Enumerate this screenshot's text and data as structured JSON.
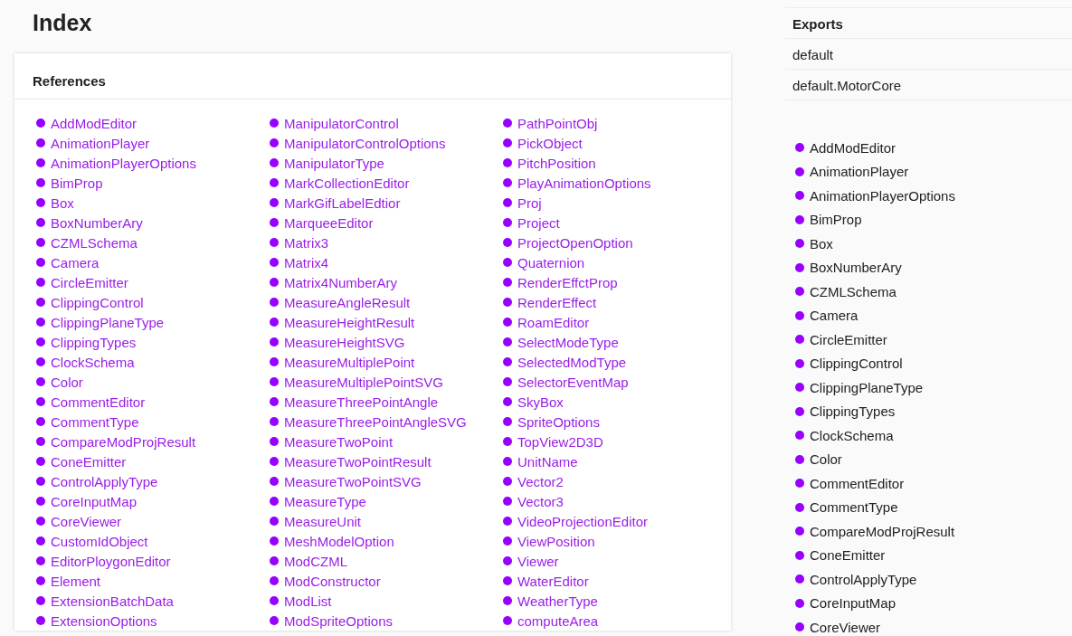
{
  "page": {
    "title": "Index"
  },
  "references": {
    "title": "References",
    "columns": [
      {
        "items": [
          "AddModEditor",
          "AnimationPlayer",
          "AnimationPlayerOptions",
          "BimProp",
          "Box",
          "BoxNumberAry",
          "CZMLSchema",
          "Camera",
          "CircleEmitter",
          "ClippingControl",
          "ClippingPlaneType",
          "ClippingTypes",
          "ClockSchema",
          "Color",
          "CommentEditor",
          "CommentType",
          "CompareModProjResult",
          "ConeEmitter",
          "ControlApplyType",
          "CoreInputMap",
          "CoreViewer",
          "CustomIdObject",
          "EditorPloygonEditor",
          "Element",
          "ExtensionBatchData",
          "ExtensionOptions"
        ]
      },
      {
        "items": [
          "ManipulatorControl",
          "ManipulatorControlOptions",
          "ManipulatorType",
          "MarkCollectionEditor",
          "MarkGifLabelEdtior",
          "MarqueeEditor",
          "Matrix3",
          "Matrix4",
          "Matrix4NumberAry",
          "MeasureAngleResult",
          "MeasureHeightResult",
          "MeasureHeightSVG",
          "MeasureMultiplePoint",
          "MeasureMultiplePointSVG",
          "MeasureThreePointAngle",
          "MeasureThreePointAngleSVG",
          "MeasureTwoPoint",
          "MeasureTwoPointResult",
          "MeasureTwoPointSVG",
          "MeasureType",
          "MeasureUnit",
          "MeshModelOption",
          "ModCZML",
          "ModConstructor",
          "ModList",
          "ModSpriteOptions"
        ]
      },
      {
        "items": [
          "PathPointObj",
          "PickObject",
          "PitchPosition",
          "PlayAnimationOptions",
          "Proj",
          "Project",
          "ProjectOpenOption",
          "Quaternion",
          "RenderEffctProp",
          "RenderEffect",
          "RoamEditor",
          "SelectModeType",
          "SelectedModType",
          "SelectorEventMap",
          "SkyBox",
          "SpriteOptions",
          "TopView2D3D",
          "UnitName",
          "Vector2",
          "Vector3",
          "VideoProjectionEditor",
          "ViewPosition",
          "Viewer",
          "WaterEditor",
          "WeatherType",
          "computeArea"
        ]
      }
    ]
  },
  "exports": {
    "title": "Exports",
    "rows": [
      "default",
      "default.MotorCore"
    ]
  },
  "navigation": {
    "items": [
      "AddModEditor",
      "AnimationPlayer",
      "AnimationPlayerOptions",
      "BimProp",
      "Box",
      "BoxNumberAry",
      "CZMLSchema",
      "Camera",
      "CircleEmitter",
      "ClippingControl",
      "ClippingPlaneType",
      "ClippingTypes",
      "ClockSchema",
      "Color",
      "CommentEditor",
      "CommentType",
      "CompareModProjResult",
      "ConeEmitter",
      "ControlApplyType",
      "CoreInputMap",
      "CoreViewer"
    ]
  }
}
